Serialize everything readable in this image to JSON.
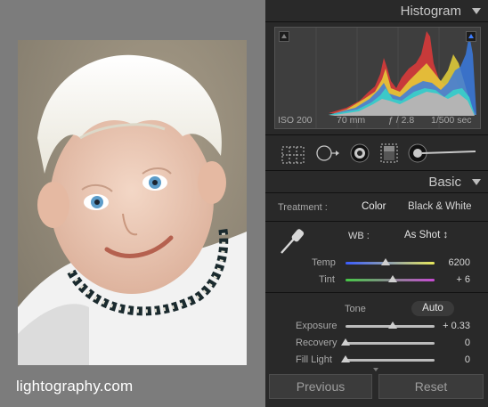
{
  "viewer": {
    "watermark": "lightography.com"
  },
  "histogram_panel": {
    "title": "Histogram",
    "iso": "ISO 200",
    "focal_length": "70 mm",
    "aperture": "ƒ / 2.8",
    "shutter": "1/500 sec"
  },
  "tools": [
    "crop-overlay",
    "spot-removal",
    "red-eye-correction",
    "graduated-filter",
    "adjustment-brush"
  ],
  "basic_panel": {
    "title": "Basic",
    "treatment_label": "Treatment :",
    "treatment_options": [
      "Color",
      "Black & White"
    ],
    "treatment_selected": "Color",
    "wb_label": "WB :",
    "wb_value": "As Shot ↕",
    "temp": {
      "label": "Temp",
      "value": "6200",
      "level": 0.45
    },
    "tint": {
      "label": "Tint",
      "value": "+ 6",
      "level": 0.53
    },
    "tone_label": "Tone",
    "auto_label": "Auto",
    "exposure": {
      "label": "Exposure",
      "value": "+ 0.33",
      "level": 0.53
    },
    "recovery": {
      "label": "Recovery",
      "value": "0",
      "level": 0
    },
    "fill_light": {
      "label": "Fill Light",
      "value": "0",
      "level": 0
    }
  },
  "footer": {
    "previous_label": "Previous",
    "reset_label": "Reset"
  },
  "colors": {
    "temp_track_start": "#3a5cff",
    "temp_track_end": "#e8e85a",
    "tint_track_start": "#46c846",
    "tint_track_end": "#c84ad4"
  }
}
